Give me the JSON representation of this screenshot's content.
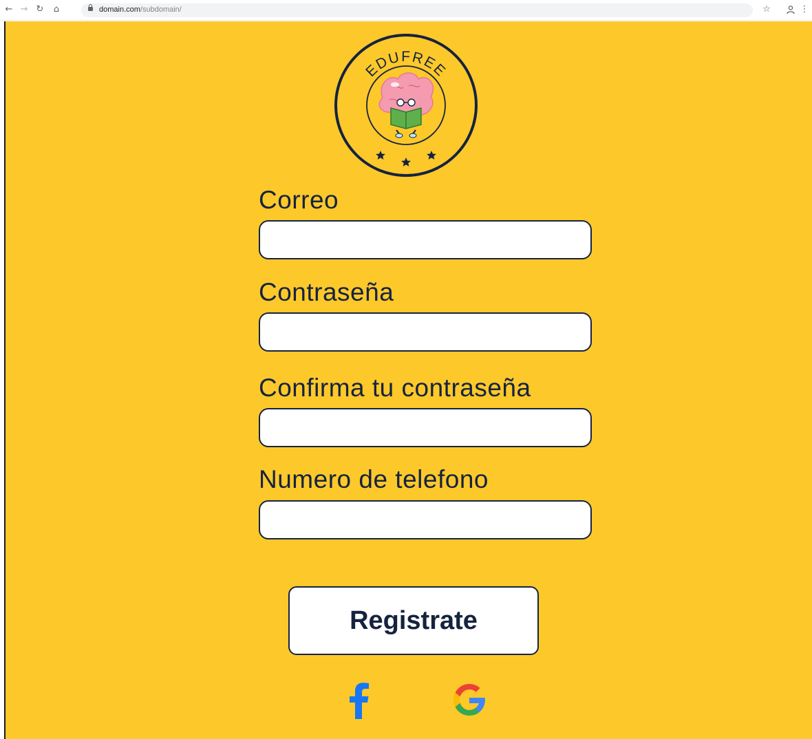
{
  "browser": {
    "url_domain": "domain.com",
    "url_path": "/subdomain/",
    "icons": [
      "back-arrow-icon",
      "forward-arrow-icon",
      "reload-icon",
      "home-icon",
      "lock-icon",
      "star-icon",
      "profile-icon",
      "menu-icon"
    ]
  },
  "logo": {
    "brand": "EDUFREE",
    "icon": "brain-reading-book-icon"
  },
  "form": {
    "email_label": "Correo",
    "email_value": "",
    "password_label": "Contraseña",
    "password_value": "",
    "confirm_label": "Confirma tu contraseña",
    "confirm_value": "",
    "phone_label": "Numero de telefono",
    "phone_value": "",
    "submit_label": "Registrate"
  },
  "social": {
    "facebook_icon": "facebook-icon",
    "google_icon": "google-icon"
  },
  "colors": {
    "background": "#fdc82a",
    "text": "#15233f",
    "input_bg": "#ffffff",
    "facebook": "#1877f2"
  }
}
